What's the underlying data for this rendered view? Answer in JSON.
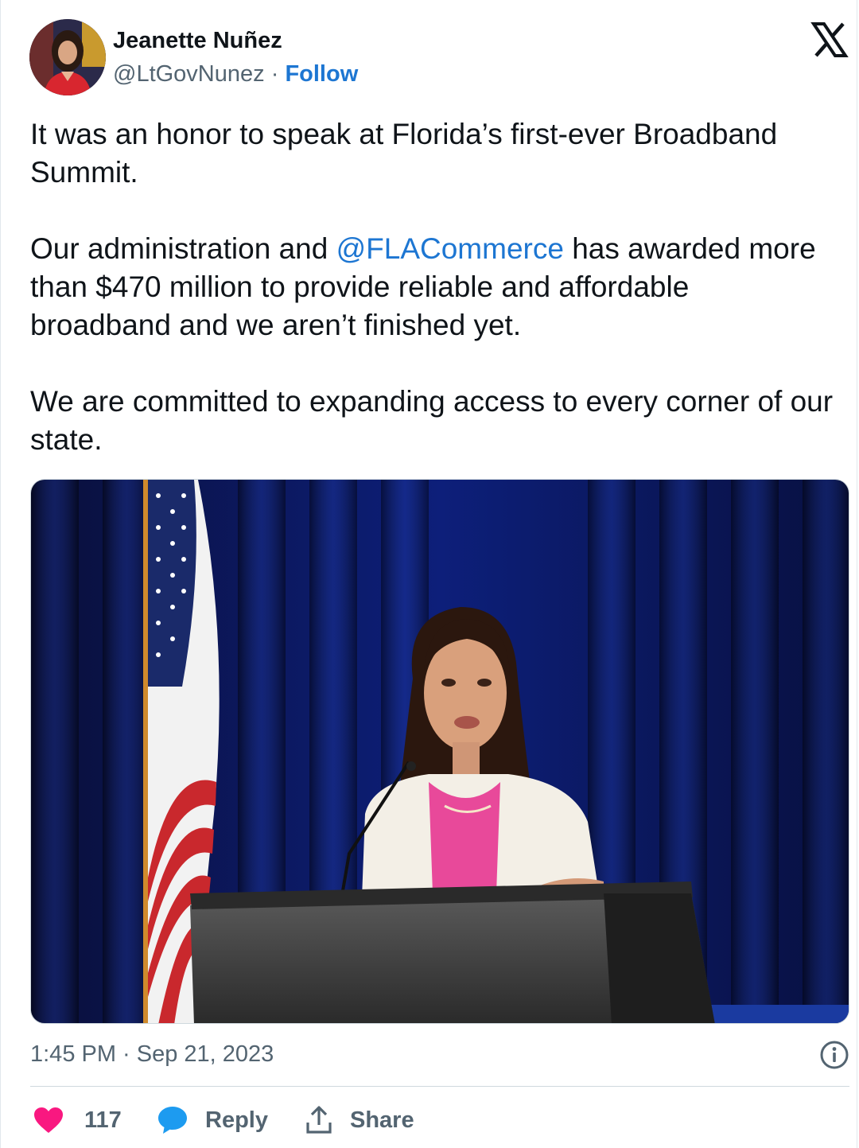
{
  "author": {
    "name": "Jeanette Nuñez",
    "handle": "@LtGovNunez",
    "separator": "·",
    "follow_label": "Follow"
  },
  "tweet": {
    "paragraphs": [
      "It was an honor to speak at Florida’s first-ever Broadband Summit.",
      "has awarded more than $470 million to provide reliable and affordable broadband and we aren’t finished yet.",
      "We are committed to expanding access to every corner of our state."
    ],
    "p2_prefix": "Our administration and ",
    "mention": "@FLACommerce",
    "p2_suffix": " has awarded more than $470 million to provide reliable and affordable broadband and we aren’t finished yet."
  },
  "timestamp": "1:45 PM · Sep 21, 2023",
  "actions": {
    "like_count": "117",
    "reply_label": "Reply",
    "share_label": "Share"
  },
  "colors": {
    "link": "#1d76d2",
    "muted": "#536471",
    "like": "#f91880",
    "reply_icon": "#1d9bf0"
  },
  "icons": {
    "brand": "x-logo-icon",
    "info": "info-icon",
    "like": "heart-icon",
    "reply": "speech-bubble-icon",
    "share": "share-upload-icon"
  }
}
